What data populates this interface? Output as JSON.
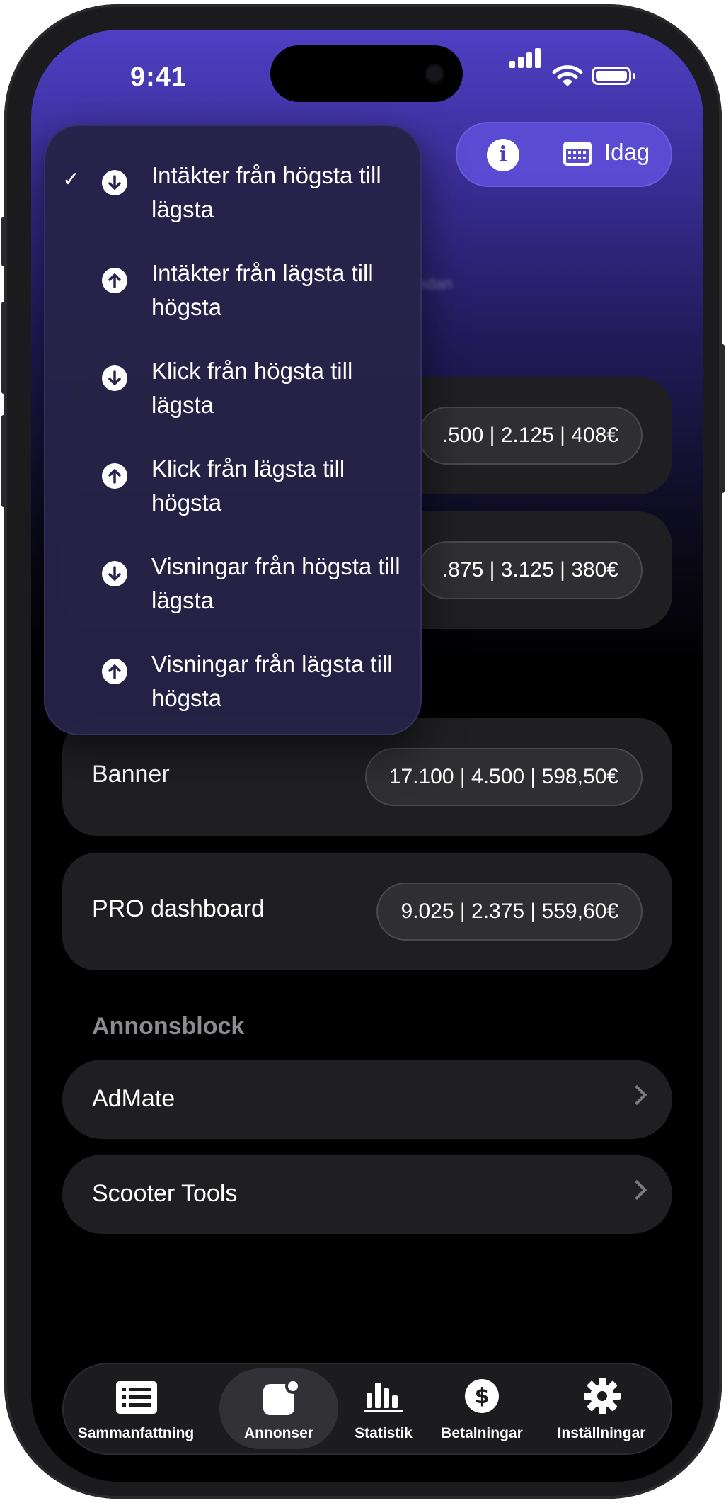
{
  "status_bar": {
    "time": "9:41"
  },
  "header": {
    "date_label": "Idag",
    "blurred_subtitle_fragment": "edan"
  },
  "ad_cards": [
    {
      "label": "",
      "stats": ".500 | 2.125 | 408€"
    },
    {
      "label": "",
      "stats": ".875 | 3.125 | 380€"
    },
    {
      "label": "Banner",
      "stats": "17.100 | 4.500 | 598,50€"
    },
    {
      "label": "PRO dashboard",
      "stats": "9.025 | 2.375 | 559,60€"
    }
  ],
  "ad_blocks": {
    "title": "Annonsblock",
    "items": [
      {
        "label": "AdMate"
      },
      {
        "label": "Scooter Tools"
      }
    ]
  },
  "sort_menu": {
    "selected_index": 0,
    "items": [
      {
        "label": "Intäkter från högsta till lägsta",
        "direction": "down"
      },
      {
        "label": "Intäkter från lägsta till högsta",
        "direction": "up"
      },
      {
        "label": "Klick från högsta till lägsta",
        "direction": "down"
      },
      {
        "label": "Klick från lägsta till högsta",
        "direction": "up"
      },
      {
        "label": "Visningar från högsta till lägsta",
        "direction": "down"
      },
      {
        "label": "Visningar från lägsta till högsta",
        "direction": "up"
      }
    ]
  },
  "tab_bar": {
    "active": "Annonser",
    "tabs": [
      {
        "label": "Sammanfattning",
        "icon": "list-icon"
      },
      {
        "label": "Annonser",
        "icon": "ads-icon"
      },
      {
        "label": "Statistik",
        "icon": "bar-chart-icon"
      },
      {
        "label": "Betalningar",
        "icon": "dollar-icon"
      },
      {
        "label": "Inställningar",
        "icon": "gear-icon"
      }
    ]
  },
  "colors": {
    "accent": "#4f3fc4",
    "card": "#1f1f22",
    "pill": "#2f2f32",
    "muted": "#8b8b90"
  }
}
